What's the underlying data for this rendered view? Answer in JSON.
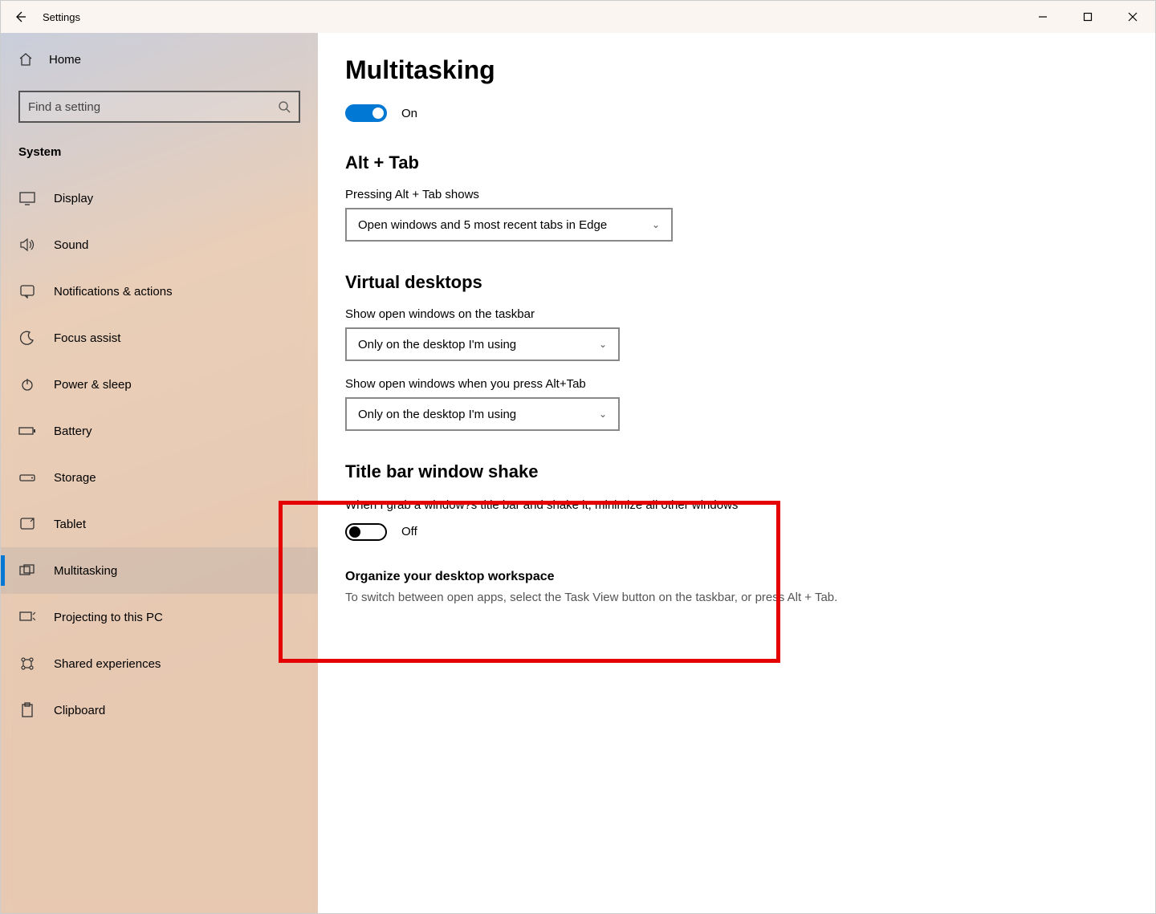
{
  "titlebar": {
    "title": "Settings"
  },
  "sidebar": {
    "home_label": "Home",
    "search_placeholder": "Find a setting",
    "category_label": "System",
    "items": [
      {
        "label": "Display",
        "icon": "display"
      },
      {
        "label": "Sound",
        "icon": "sound"
      },
      {
        "label": "Notifications & actions",
        "icon": "notifications"
      },
      {
        "label": "Focus assist",
        "icon": "moon"
      },
      {
        "label": "Power & sleep",
        "icon": "power"
      },
      {
        "label": "Battery",
        "icon": "battery"
      },
      {
        "label": "Storage",
        "icon": "storage"
      },
      {
        "label": "Tablet",
        "icon": "tablet"
      },
      {
        "label": "Multitasking",
        "icon": "multitasking",
        "active": true
      },
      {
        "label": "Projecting to this PC",
        "icon": "project"
      },
      {
        "label": "Shared experiences",
        "icon": "share"
      },
      {
        "label": "Clipboard",
        "icon": "clipboard"
      }
    ]
  },
  "main": {
    "page_title": "Multitasking",
    "global_toggle": {
      "state": "On"
    },
    "alttab": {
      "heading": "Alt + Tab",
      "label": "Pressing Alt + Tab shows",
      "value": "Open windows and 5 most recent tabs in Edge"
    },
    "virtual": {
      "heading": "Virtual desktops",
      "taskbar_label": "Show open windows on the taskbar",
      "taskbar_value": "Only on the desktop I'm using",
      "alttab_label": "Show open windows when you press Alt+Tab",
      "alttab_value": "Only on the desktop I'm using"
    },
    "shake": {
      "heading": "Title bar window shake",
      "desc": "When I grab a window?s title bar and shake it, minimize all other windows",
      "state": "Off"
    },
    "organize": {
      "heading": "Organize your desktop workspace",
      "text": "To switch between open apps, select the Task View button on the taskbar, or press Alt + Tab."
    }
  }
}
